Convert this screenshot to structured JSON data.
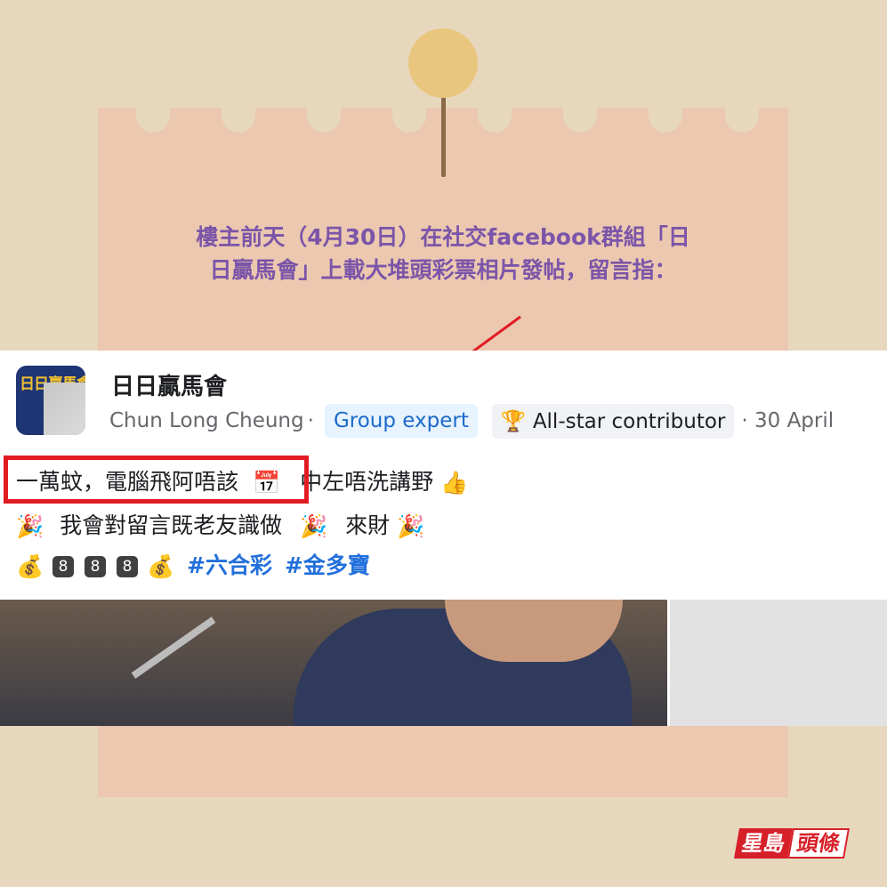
{
  "caption": {
    "line1": "樓主前天（4月30日）在社交facebook群組「日",
    "line2": "日贏馬會」上載大堆頭彩票相片發帖，留言指："
  },
  "post": {
    "group_name": "日日贏馬會",
    "avatar_text": "日日贏馬會",
    "author": "Chun Long Cheung",
    "separator": "·",
    "badge_expert": "Group expert",
    "badge_contributor": "All-star contributor",
    "date": "· 30 April",
    "line1_highlight": "一萬蚊，電腦飛阿唔該",
    "line1_rest": "中左唔洗講野",
    "line2_a": "我會對留言既老友識做",
    "line2_b": "來財",
    "line3_nums": [
      "8",
      "8",
      "8"
    ],
    "hashtag1": "#六合彩",
    "hashtag2": "#金多寶"
  },
  "logo": {
    "part1": "星島",
    "part2": "頭條"
  },
  "colors": {
    "caption": "#7b55a8",
    "highlight": "#e21b23",
    "hashtag": "#216fdb"
  }
}
